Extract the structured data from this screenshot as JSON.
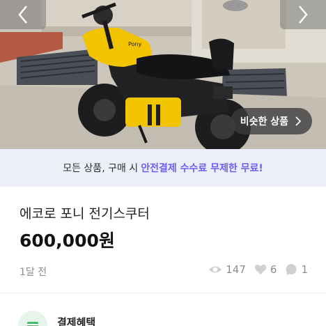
{
  "navigation": {
    "prev_icon": "chevron-left-icon",
    "next_icon": "chevron-right-icon"
  },
  "photo": {
    "similar_button_label": "비슷한 상품",
    "similar_button_icon": "chevron-right-icon",
    "scooter_brand_mark": "Pony"
  },
  "banner": {
    "prefix": "모든 상품, 구매 시",
    "highlight": "안전결제 수수료 무제한 무료!"
  },
  "product": {
    "title": "에코로 포니 전기스쿠터",
    "price": "600,000원",
    "posted": "1달 전"
  },
  "stats": {
    "views": "147",
    "likes": "6",
    "chats": "1"
  },
  "benefit": {
    "title": "결제혜택"
  },
  "colors": {
    "accent": "#6b5ff5",
    "banner_bg": "#eceef9",
    "scooter_yellow": "#f2c400"
  }
}
